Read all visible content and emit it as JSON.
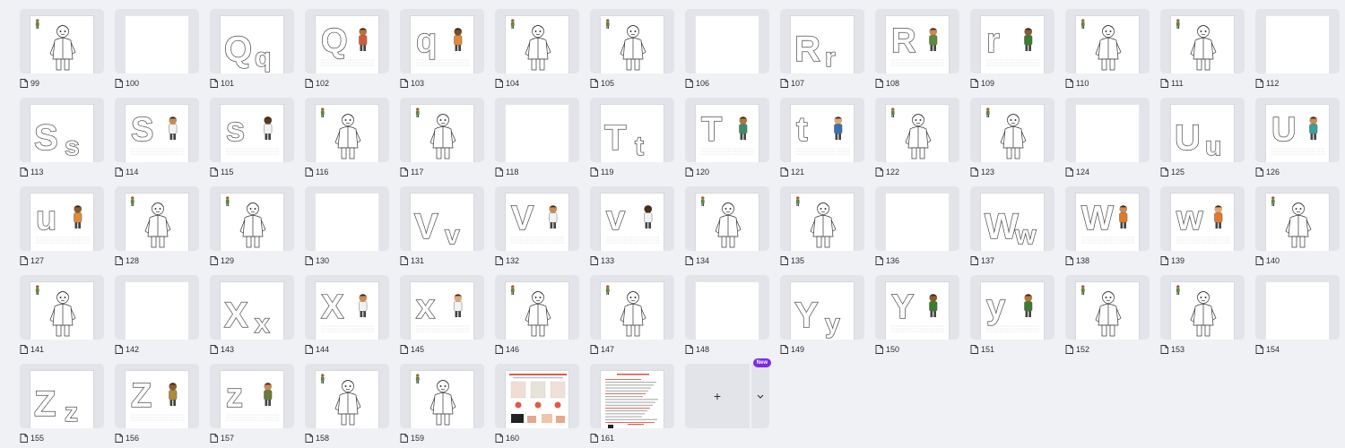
{
  "grid": {
    "pages": [
      {
        "label": "99",
        "kind": "figure",
        "mini": true
      },
      {
        "label": "100",
        "kind": "blank"
      },
      {
        "label": "101",
        "kind": "letters",
        "upper": "Q",
        "lower": "q"
      },
      {
        "label": "102",
        "kind": "letter-figure",
        "letter": "Q",
        "skin": "#b3743b",
        "outfit": "#cf5a3a"
      },
      {
        "label": "103",
        "kind": "letter-figure",
        "letter": "q",
        "skin": "#7a4c2a",
        "outfit": "#e08a3a"
      },
      {
        "label": "104",
        "kind": "figure"
      },
      {
        "label": "105",
        "kind": "figure"
      },
      {
        "label": "106",
        "kind": "blank"
      },
      {
        "label": "107",
        "kind": "letters",
        "upper": "R",
        "lower": "r"
      },
      {
        "label": "108",
        "kind": "letter-figure",
        "letter": "R",
        "skin": "#c98a55",
        "outfit": "#5d8a3a"
      },
      {
        "label": "109",
        "kind": "letter-figure",
        "letter": "r",
        "skin": "#8a5a34",
        "outfit": "#3f7a33"
      },
      {
        "label": "110",
        "kind": "figure"
      },
      {
        "label": "111",
        "kind": "figure"
      },
      {
        "label": "112",
        "kind": "blank"
      },
      {
        "label": "113",
        "kind": "letters",
        "upper": "S",
        "lower": "s"
      },
      {
        "label": "114",
        "kind": "letter-figure",
        "letter": "S",
        "skin": "#c98a55",
        "outfit": "#f2f2f2"
      },
      {
        "label": "115",
        "kind": "letter-figure",
        "letter": "s",
        "skin": "#5a3a22",
        "outfit": "#f2f2f2"
      },
      {
        "label": "116",
        "kind": "figure"
      },
      {
        "label": "117",
        "kind": "figure"
      },
      {
        "label": "118",
        "kind": "blank"
      },
      {
        "label": "119",
        "kind": "letters",
        "upper": "T",
        "lower": "t"
      },
      {
        "label": "120",
        "kind": "letter-figure",
        "letter": "T",
        "skin": "#b3743b",
        "outfit": "#3f8a6a"
      },
      {
        "label": "121",
        "kind": "letter-figure",
        "letter": "t",
        "skin": "#e0a877",
        "outfit": "#3c6fb0"
      },
      {
        "label": "122",
        "kind": "figure"
      },
      {
        "label": "123",
        "kind": "figure"
      },
      {
        "label": "124",
        "kind": "blank"
      },
      {
        "label": "125",
        "kind": "letters",
        "upper": "U",
        "lower": "u"
      },
      {
        "label": "126",
        "kind": "letter-figure",
        "letter": "U",
        "skin": "#c98a55",
        "outfit": "#3aa09a"
      },
      {
        "label": "127",
        "kind": "letter-figure",
        "letter": "u",
        "skin": "#8a5a34",
        "outfit": "#e08a3a"
      },
      {
        "label": "128",
        "kind": "figure"
      },
      {
        "label": "129",
        "kind": "figure"
      },
      {
        "label": "130",
        "kind": "blank"
      },
      {
        "label": "131",
        "kind": "letters",
        "upper": "V",
        "lower": "v"
      },
      {
        "label": "132",
        "kind": "letter-figure",
        "letter": "V",
        "skin": "#c98a55",
        "outfit": "#f2f2f2"
      },
      {
        "label": "133",
        "kind": "letter-figure",
        "letter": "v",
        "skin": "#4a2f1c",
        "outfit": "#f2f2f2"
      },
      {
        "label": "134",
        "kind": "figure"
      },
      {
        "label": "135",
        "kind": "figure"
      },
      {
        "label": "136",
        "kind": "blank"
      },
      {
        "label": "137",
        "kind": "letters",
        "upper": "W",
        "lower": "w"
      },
      {
        "label": "138",
        "kind": "letter-figure",
        "letter": "W",
        "skin": "#c98a55",
        "outfit": "#e07a2a"
      },
      {
        "label": "139",
        "kind": "letter-figure",
        "letter": "w",
        "skin": "#e0a877",
        "outfit": "#e07a2a"
      },
      {
        "label": "140",
        "kind": "figure"
      },
      {
        "label": "141",
        "kind": "figure"
      },
      {
        "label": "142",
        "kind": "blank"
      },
      {
        "label": "143",
        "kind": "letters",
        "upper": "X",
        "lower": "x"
      },
      {
        "label": "144",
        "kind": "letter-figure",
        "letter": "X",
        "skin": "#c98a55",
        "outfit": "#f2f2f2"
      },
      {
        "label": "145",
        "kind": "letter-figure",
        "letter": "x",
        "skin": "#e0a877",
        "outfit": "#f2f2f2"
      },
      {
        "label": "146",
        "kind": "figure"
      },
      {
        "label": "147",
        "kind": "figure"
      },
      {
        "label": "148",
        "kind": "blank"
      },
      {
        "label": "149",
        "kind": "letters",
        "upper": "Y",
        "lower": "y"
      },
      {
        "label": "150",
        "kind": "letter-figure",
        "letter": "Y",
        "skin": "#8a5a34",
        "outfit": "#3f7a33"
      },
      {
        "label": "151",
        "kind": "letter-figure",
        "letter": "y",
        "skin": "#b3743b",
        "outfit": "#3f7a33"
      },
      {
        "label": "152",
        "kind": "figure"
      },
      {
        "label": "153",
        "kind": "figure"
      },
      {
        "label": "154",
        "kind": "blank"
      },
      {
        "label": "155",
        "kind": "letters",
        "upper": "Z",
        "lower": "z"
      },
      {
        "label": "156",
        "kind": "letter-figure",
        "letter": "Z",
        "skin": "#8a5a34",
        "outfit": "#b08a3a"
      },
      {
        "label": "157",
        "kind": "letter-figure",
        "letter": "z",
        "skin": "#c98a55",
        "outfit": "#6a7a3a"
      },
      {
        "label": "158",
        "kind": "figure"
      },
      {
        "label": "159",
        "kind": "figure"
      },
      {
        "label": "160",
        "kind": "cover"
      },
      {
        "label": "161",
        "kind": "instructions"
      }
    ]
  },
  "add_page": {
    "plus": "+",
    "badge": "New",
    "chevron": "chevron-down-icon"
  },
  "colors": {
    "thumb_bg": "#e3e4ea",
    "canvas_bg": "#f0f1f5",
    "badge": "#7d2ae8",
    "ink": "#2b2d33"
  }
}
